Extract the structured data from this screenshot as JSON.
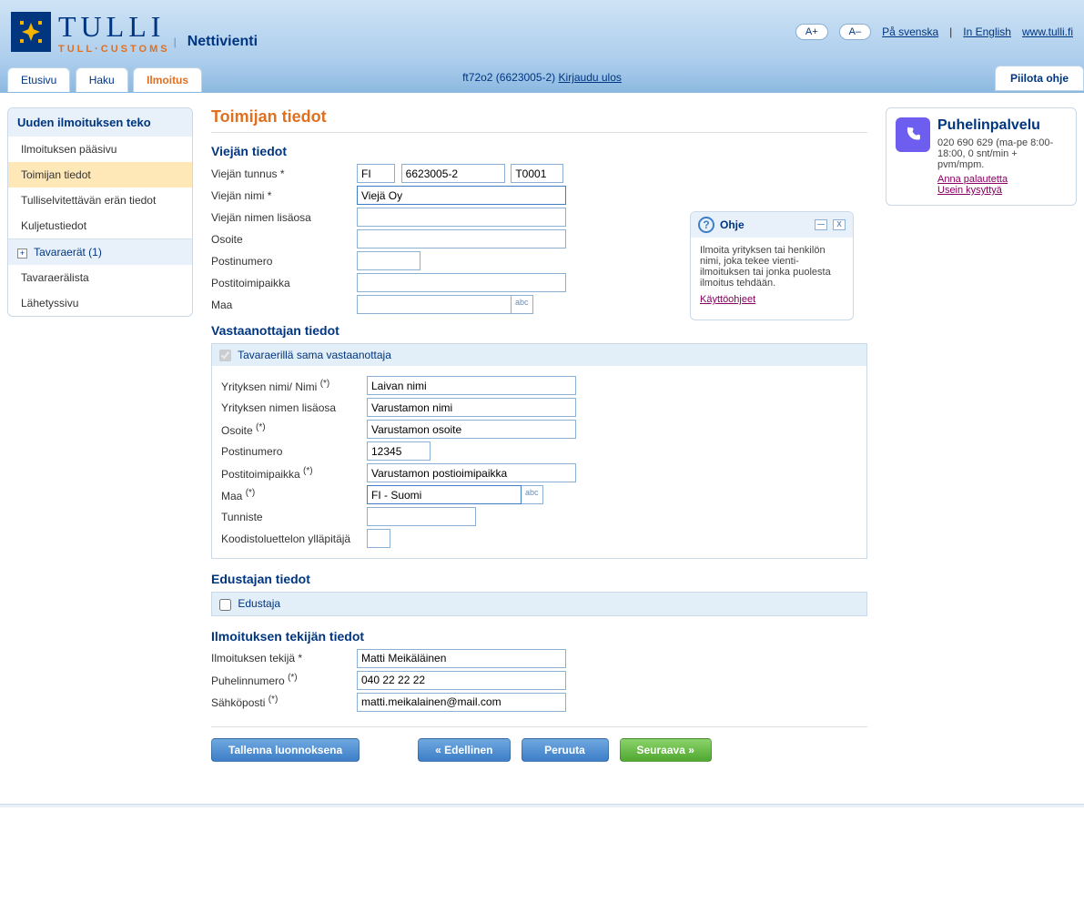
{
  "header": {
    "brand_main": "TULLI",
    "brand_sub": "TULL·CUSTOMS",
    "service": "Nettivienti",
    "font_plus": "A+",
    "font_minus": "A–",
    "lang_sv": "På svenska",
    "lang_en": "In English",
    "site_link": "www.tulli.fi"
  },
  "tabs": {
    "t0": "Etusivu",
    "t1": "Haku",
    "t2": "Ilmoitus"
  },
  "user": {
    "id": "ft72o2 (6623005-2)",
    "logout": "Kirjaudu ulos"
  },
  "hide_help": "Piilota ohje",
  "sidebar": {
    "heading": "Uuden ilmoituksen teko",
    "items": {
      "i0": "Ilmoituksen pääsivu",
      "i1": "Toimijan tiedot",
      "i2": "Tulliselvitettävän erän tiedot",
      "i3": "Kuljetustiedot"
    },
    "group": "Tavaraerät (1)",
    "items2": {
      "i4": "Tavaraerälista",
      "i5": "Lähetyssivu"
    }
  },
  "main": {
    "title": "Toimijan tiedot",
    "sect1": "Viejän tiedot",
    "vieja": {
      "tunnus_label": "Viejän tunnus *",
      "tunnus_a": "FI",
      "tunnus_b": "6623005-2",
      "tunnus_c": "T0001",
      "nimi_label": "Viejän nimi *",
      "nimi_val": "Viejä Oy",
      "lisa_label": "Viejän nimen lisäosa",
      "osoite_label": "Osoite",
      "postinro_label": "Postinumero",
      "postitp_label": "Postitoimipaikka",
      "maa_label": "Maa",
      "abc": "abc"
    },
    "sect2": "Vastaanottajan tiedot",
    "recv": {
      "same_label": "Tavaraerillä sama vastaanottaja",
      "yritys_label": "Yrityksen nimi/ Nimi",
      "yritys_val": "Laivan nimi",
      "lisa_label": "Yrityksen nimen lisäosa",
      "lisa_val": "Varustamon nimi",
      "osoite_label": "Osoite",
      "osoite_val": "Varustamon osoite",
      "postinro_label": "Postinumero",
      "postinro_val": "12345",
      "postitp_label": "Postitoimipaikka",
      "postitp_val": "Varustamon postioimipaikka",
      "maa_label": "Maa",
      "maa_val": "FI - Suomi",
      "tunniste_label": "Tunniste",
      "koodisto_label": "Koodistoluettelon ylläpitäjä",
      "abc": "abc"
    },
    "sect3": "Edustajan tiedot",
    "edustaja_label": "Edustaja",
    "sect4": "Ilmoituksen tekijän tiedot",
    "reporter": {
      "tekija_label": "Ilmoituksen tekijä *",
      "tekija_val": "Matti Meikäläinen",
      "puh_label": "Puhelinnumero",
      "puh_val": "040 22 22 22",
      "email_label": "Sähköposti",
      "email_val": "matti.meikalainen@mail.com"
    },
    "btns": {
      "save": "Tallenna luonnoksena",
      "prev": "«  Edellinen",
      "cancel": "Peruuta",
      "next": "Seuraava  »"
    }
  },
  "help": {
    "title": "Ohje",
    "body": "Ilmoita yrityksen tai henkilön nimi, joka tekee vienti-ilmoituksen tai jonka puolesta ilmoitus tehdään.",
    "link": "Käyttöohjeet"
  },
  "phone": {
    "title": "Puhelinpalvelu",
    "text": "020 690 629 (ma-pe 8:00-18:00, 0 snt/min + pvm/mpm.",
    "link1": "Anna palautetta",
    "link2": "Usein kysyttyä"
  },
  "star": "(*)"
}
